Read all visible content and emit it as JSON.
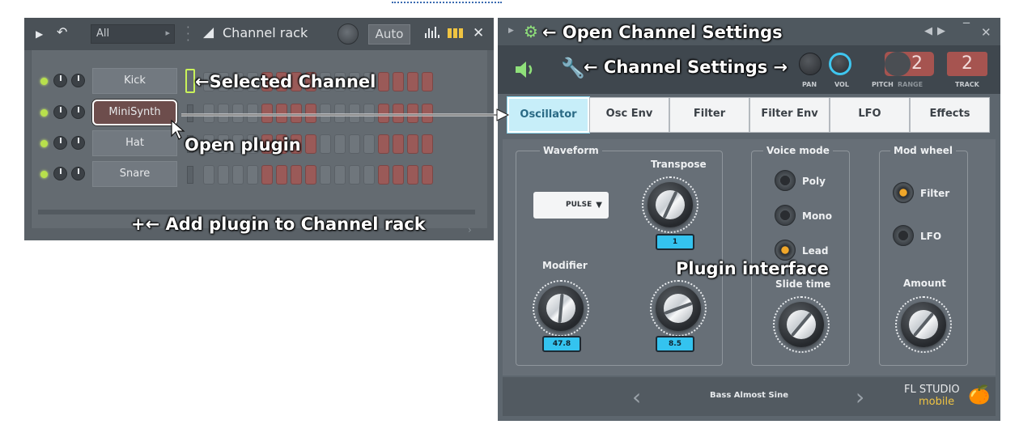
{
  "rack": {
    "filter": "All",
    "title": "Channel rack",
    "auto": "Auto",
    "channels": [
      {
        "name": "Kick"
      },
      {
        "name": "MiniSynth"
      },
      {
        "name": "Hat"
      },
      {
        "name": "Snare"
      }
    ]
  },
  "plugin": {
    "knob_labels": {
      "pan": "PAN",
      "vol": "VOL",
      "pitch": "PITCH",
      "range": "RANGE",
      "track": "TRACK"
    },
    "pitch_range": "2",
    "track": "2",
    "tabs": [
      "Oscillator",
      "Osc Env",
      "Filter",
      "Filter Env",
      "LFO",
      "Effects"
    ],
    "active_tab": "Oscillator",
    "waveform": {
      "title": "Waveform",
      "select": "PULSE",
      "transpose_label": "Transpose",
      "transpose_value": "1",
      "modifier_label": "Modifier",
      "modifier_value": "47.8",
      "knob4_value": "8.5"
    },
    "voice_mode": {
      "title": "Voice mode",
      "options": [
        "Poly",
        "Mono",
        "Lead"
      ],
      "selected": "Lead",
      "slide_label": "Slide time"
    },
    "mod_wheel": {
      "title": "Mod wheel",
      "options": [
        "Filter",
        "LFO"
      ],
      "selected": "Filter",
      "amount_label": "Amount"
    },
    "preset": "Bass Almost Sine",
    "logo_line1": "FL STUDIO",
    "logo_line2": "mobile"
  },
  "annotations": {
    "open_channel_settings": "Open Channel Settings",
    "channel_settings": "Channel Settings",
    "selected_channel": "Selected Channel",
    "open_plugin": "Open plugin",
    "add_plugin": "Add plugin to Channel rack",
    "plugin_interface": "Plugin interface"
  },
  "colors": {
    "accent": "#34c3ef",
    "selected_led": "#c9f25a",
    "step_red": "#9a5a58",
    "pitch_red": "#a65450"
  }
}
